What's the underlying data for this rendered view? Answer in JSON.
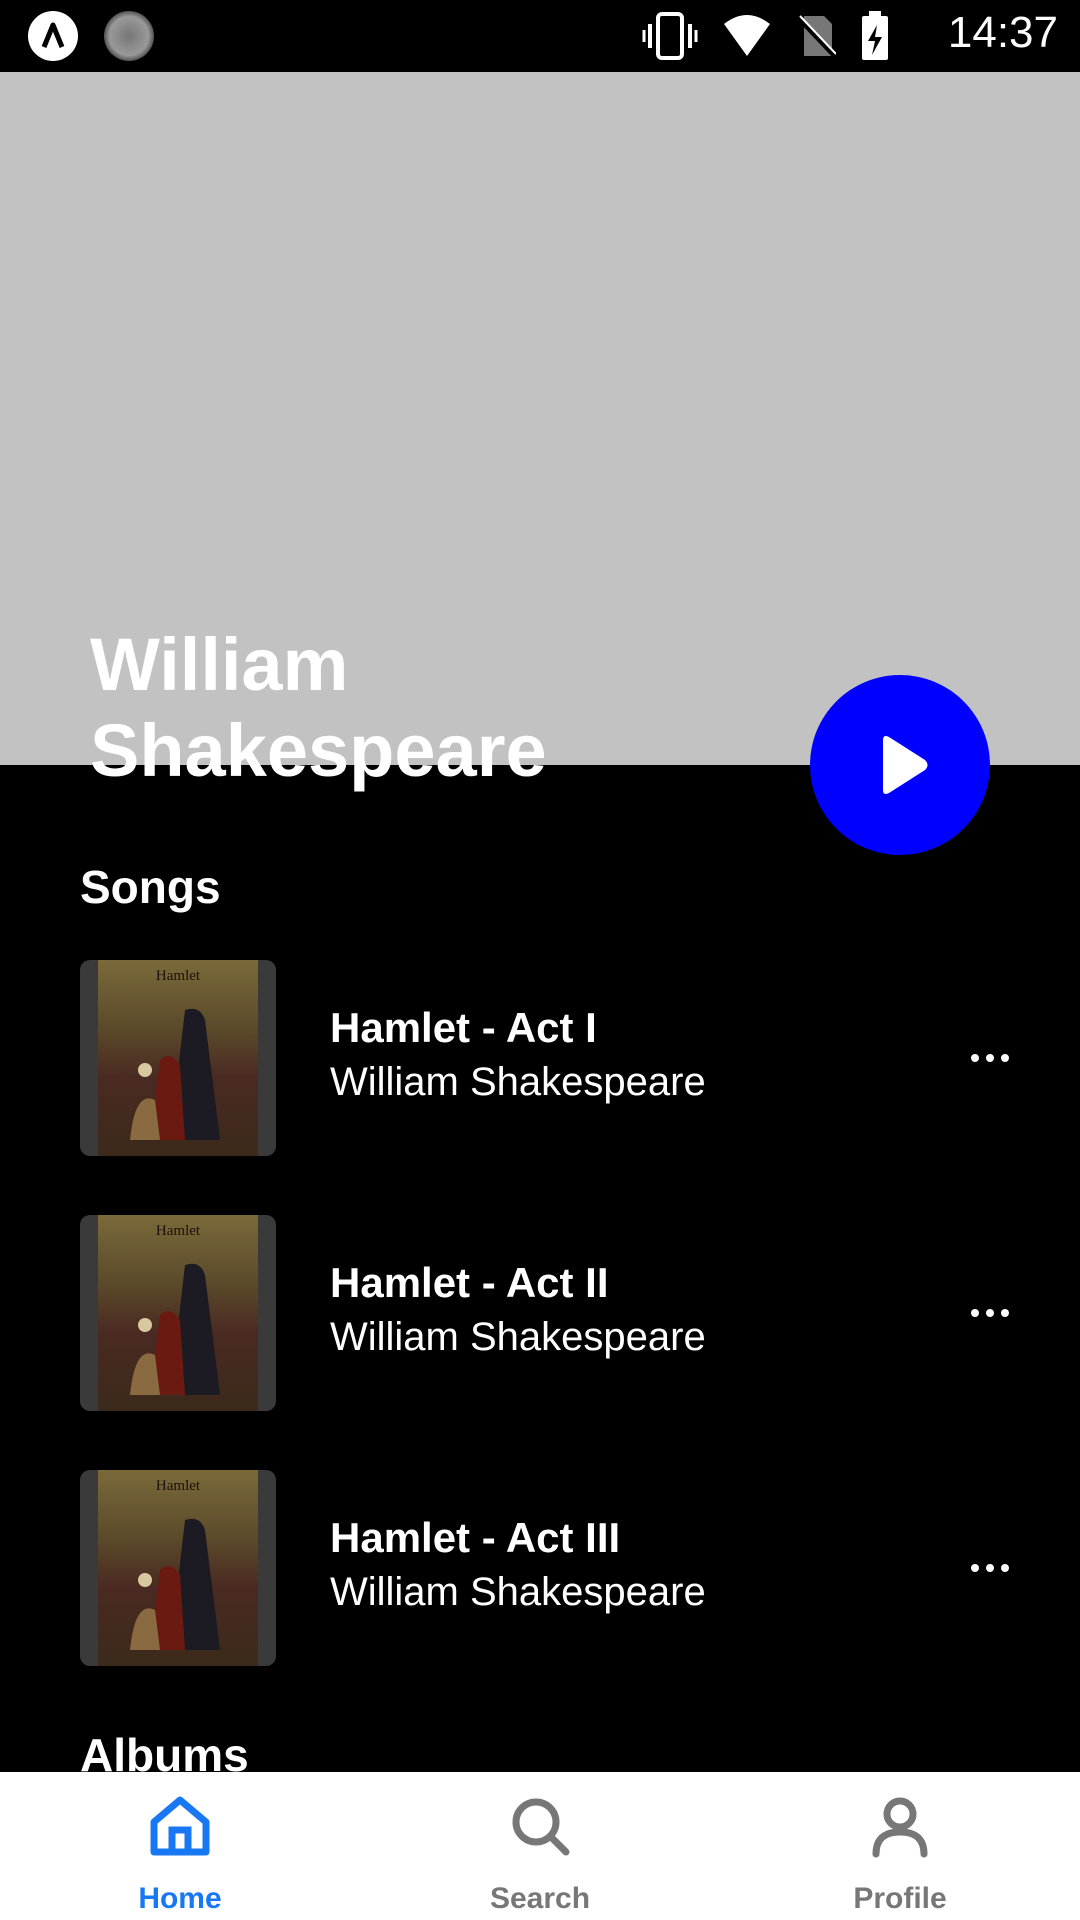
{
  "status_bar": {
    "time": "14:37"
  },
  "header": {
    "artist_name_line1": "William",
    "artist_name_line2": "Shakespeare",
    "background_color": "#c2c2c2",
    "play_button_color": "#0000ff"
  },
  "sections": {
    "songs_title": "Songs",
    "albums_title": "Albums"
  },
  "songs": [
    {
      "title": "Hamlet - Act I",
      "artist": "William Shakespeare",
      "cover_title": "Hamlet"
    },
    {
      "title": "Hamlet - Act II",
      "artist": "William Shakespeare",
      "cover_title": "Hamlet"
    },
    {
      "title": "Hamlet - Act III",
      "artist": "William Shakespeare",
      "cover_title": "Hamlet"
    }
  ],
  "bottom_nav": {
    "items": [
      {
        "label": "Home",
        "icon": "home-icon",
        "active": true,
        "color": "#1877f2"
      },
      {
        "label": "Search",
        "icon": "search-icon",
        "active": false,
        "color": "#777777"
      },
      {
        "label": "Profile",
        "icon": "profile-icon",
        "active": false,
        "color": "#777777"
      }
    ]
  }
}
